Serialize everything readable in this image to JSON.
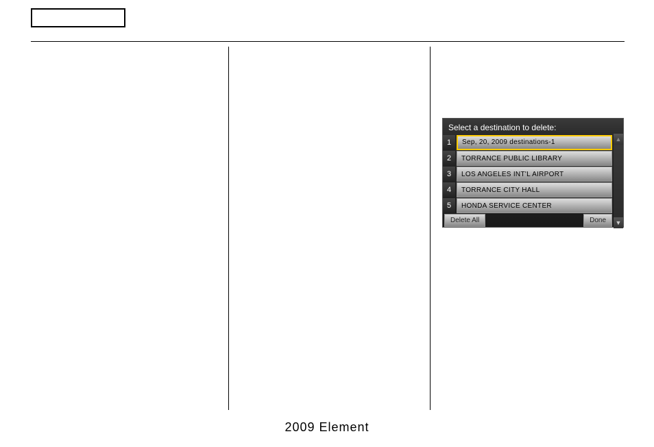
{
  "footer": {
    "model": "2009  Element"
  },
  "nav_screen": {
    "header": "Select a destination to delete:",
    "items": [
      {
        "num": "1",
        "label": "Sep, 20, 2009 destinations-1",
        "selected": true
      },
      {
        "num": "2",
        "label": "TORRANCE PUBLIC LIBRARY",
        "selected": false
      },
      {
        "num": "3",
        "label": "LOS ANGELES INT'L AIRPORT",
        "selected": false
      },
      {
        "num": "4",
        "label": "TORRANCE CITY HALL",
        "selected": false
      },
      {
        "num": "5",
        "label": "HONDA SERVICE CENTER",
        "selected": false
      }
    ],
    "delete_all_label": "Delete All",
    "done_label": "Done",
    "scroll_up": "▲",
    "scroll_down": "▼"
  }
}
